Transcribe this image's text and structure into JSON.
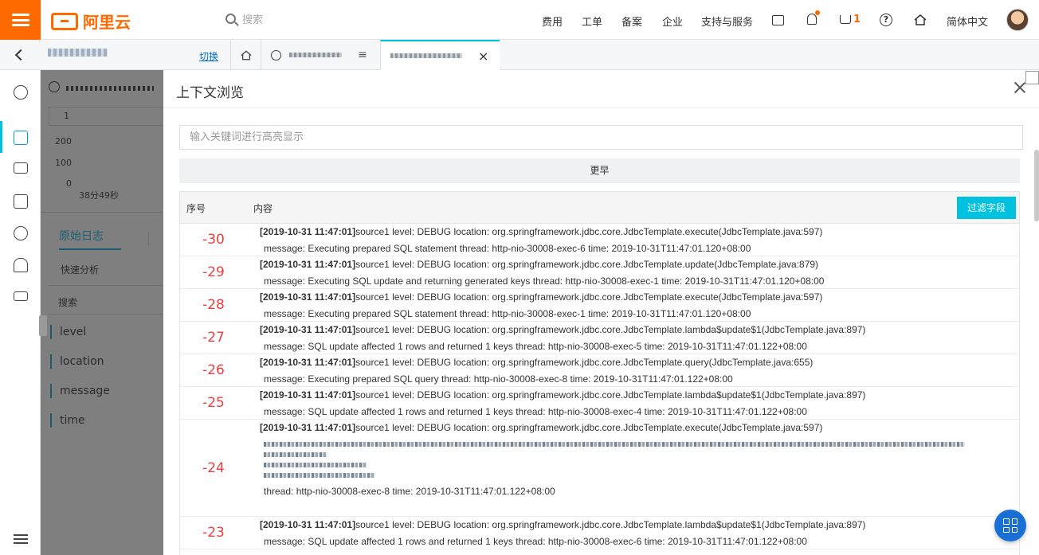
{
  "topbar": {
    "logo_text": "阿里云",
    "search_placeholder": "搜索",
    "nav": [
      "费用",
      "工单",
      "备案",
      "企业",
      "支持与服务"
    ],
    "cart_count": "1",
    "language": "简体中文",
    "icons": [
      "menu-icon",
      "search-icon",
      "terminal-icon",
      "bell-icon",
      "cart-icon",
      "help-icon",
      "home-icon"
    ]
  },
  "tabbar": {
    "switch_label": "切换",
    "close_symbol": "×"
  },
  "background": {
    "chart_y_ticks": [
      "200",
      "100",
      "0"
    ],
    "chart_x_label": "38分49秒",
    "page_tab_active": "原始日志",
    "quick_analysis": "快速分析",
    "search_placeholder": "搜索",
    "fields": [
      "level",
      "location",
      "message",
      "time"
    ],
    "box_label": "1"
  },
  "modal": {
    "title": "上下文浏览",
    "highlight_placeholder": "输入关键词进行高亮显示",
    "earlier_label": "更早",
    "col_seq": "序号",
    "col_content": "内容",
    "filter_label": "过滤字段",
    "rows": [
      {
        "seq": "-30",
        "ts": "[2019-10-31 11:47:01]",
        "line1": "source1  level: DEBUG   location: org.springframework.jdbc.core.JdbcTemplate.execute(JdbcTemplate.java:597)",
        "line2": "message: Executing prepared SQL statement   thread: http-nio-30008-exec-6   time: 2019-10-31T11:47:01.120+08:00"
      },
      {
        "seq": "-29",
        "ts": "[2019-10-31 11:47:01]",
        "line1": "source1  level: DEBUG   location: org.springframework.jdbc.core.JdbcTemplate.update(JdbcTemplate.java:879)",
        "line2": "message: Executing SQL update and returning generated keys   thread: http-nio-30008-exec-1   time: 2019-10-31T11:47:01.120+08:00"
      },
      {
        "seq": "-28",
        "ts": "[2019-10-31 11:47:01]",
        "line1": "source1  level: DEBUG   location: org.springframework.jdbc.core.JdbcTemplate.execute(JdbcTemplate.java:597)",
        "line2": "message: Executing prepared SQL statement   thread: http-nio-30008-exec-1   time: 2019-10-31T11:47:01.120+08:00"
      },
      {
        "seq": "-27",
        "ts": "[2019-10-31 11:47:01]",
        "line1": "source1  level: DEBUG   location: org.springframework.jdbc.core.JdbcTemplate.lambda$update$1(JdbcTemplate.java:897)",
        "line2": "message: SQL update affected 1 rows and returned 1 keys   thread: http-nio-30008-exec-5   time: 2019-10-31T11:47:01.122+08:00"
      },
      {
        "seq": "-26",
        "ts": "[2019-10-31 11:47:01]",
        "line1": "source1  level: DEBUG   location: org.springframework.jdbc.core.JdbcTemplate.query(JdbcTemplate.java:655)",
        "line2": "message: Executing prepared SQL query   thread: http-nio-30008-exec-8   time: 2019-10-31T11:47:01.122+08:00"
      },
      {
        "seq": "-25",
        "ts": "[2019-10-31 11:47:01]",
        "line1": "source1  level: DEBUG   location: org.springframework.jdbc.core.JdbcTemplate.lambda$update$1(JdbcTemplate.java:897)",
        "line2": "message: SQL update affected 1 rows and returned 1 keys   thread: http-nio-30008-exec-4   time: 2019-10-31T11:47:01.122+08:00"
      },
      {
        "seq": "-24",
        "ts": "[2019-10-31 11:47:01]",
        "line1": "source1  level: DEBUG   location: org.springframework.jdbc.core.JdbcTemplate.execute(JdbcTemplate.java:597)",
        "line_last": "thread: http-nio-30008-exec-8   time: 2019-10-31T11:47:01.122+08:00"
      },
      {
        "seq": "-23",
        "ts": "[2019-10-31 11:47:01]",
        "line1": "source1  level: DEBUG   location: org.springframework.jdbc.core.JdbcTemplate.lambda$update$1(JdbcTemplate.java:897)",
        "line2": "message: SQL update affected 1 rows and returned 1 keys   thread: http-nio-30008-exec-6   time: 2019-10-31T11:47:01.122+08:00"
      }
    ]
  },
  "colors": {
    "brand": "#ff6a00",
    "accent": "#00c1de",
    "seq_red": "#e84040",
    "fab_blue": "#1a6fd4"
  }
}
